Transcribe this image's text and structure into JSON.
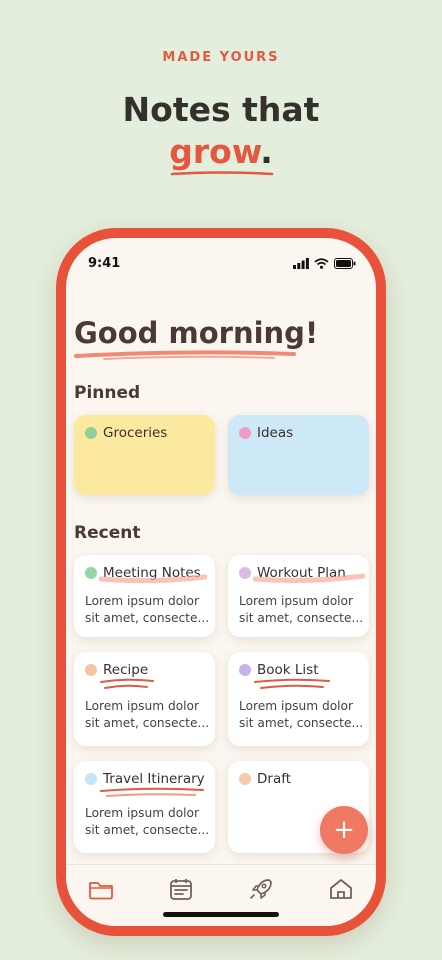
{
  "header": {
    "eyebrow": "MADE YOURS",
    "line1": "Notes that",
    "line2_accent": "grow",
    "line2_suffix": "."
  },
  "status_bar": {
    "time": "9:41"
  },
  "greeting": "Good morning!",
  "sections": {
    "pinned": "Pinned",
    "recent": "Recent"
  },
  "pinned": [
    {
      "title": "Groceries",
      "dot_color": "#8fcf9c",
      "bg": "#fbe9a0"
    },
    {
      "title": "Ideas",
      "dot_color": "#f39ac4",
      "bg": "#cde8f6"
    }
  ],
  "recent": [
    {
      "title": "Meeting Notes",
      "body1": "Lorem ipsum dolor",
      "body2": "sit amet, consecte...",
      "dot_color": "#95d6a6"
    },
    {
      "title": "Workout Plan",
      "body1": "Lorem ipsum dolor",
      "body2": "sit amet, consecte...",
      "dot_color": "#d8bde0"
    },
    {
      "title": "Recipe",
      "body1": "Lorem ipsum dolor",
      "body2": "sit amet, consecte...",
      "dot_color": "#f6c3a4"
    },
    {
      "title": "Book List",
      "body1": "Lorem ipsum dolor",
      "body2": "sit amet, consecte...",
      "dot_color": "#c8b2e6"
    },
    {
      "title": "Travel Itinerary",
      "body1": "Lorem ipsum dolor",
      "body2": "sit amet, consecte...",
      "dot_color": "#c3e4f6"
    },
    {
      "title": "Draft",
      "body1": "",
      "body2": "",
      "dot_color": "#f6c8ae"
    }
  ],
  "fab_label": "+",
  "tabs": [
    {
      "icon": "folder-icon",
      "active": true
    },
    {
      "icon": "calendar-icon",
      "active": false
    },
    {
      "icon": "rocket-icon",
      "active": false
    },
    {
      "icon": "home-icon",
      "active": false
    }
  ],
  "colors": {
    "accent": "#e3593f",
    "phone_frame": "#e8523a",
    "background": "#e3eedc",
    "fab": "#f07964"
  }
}
